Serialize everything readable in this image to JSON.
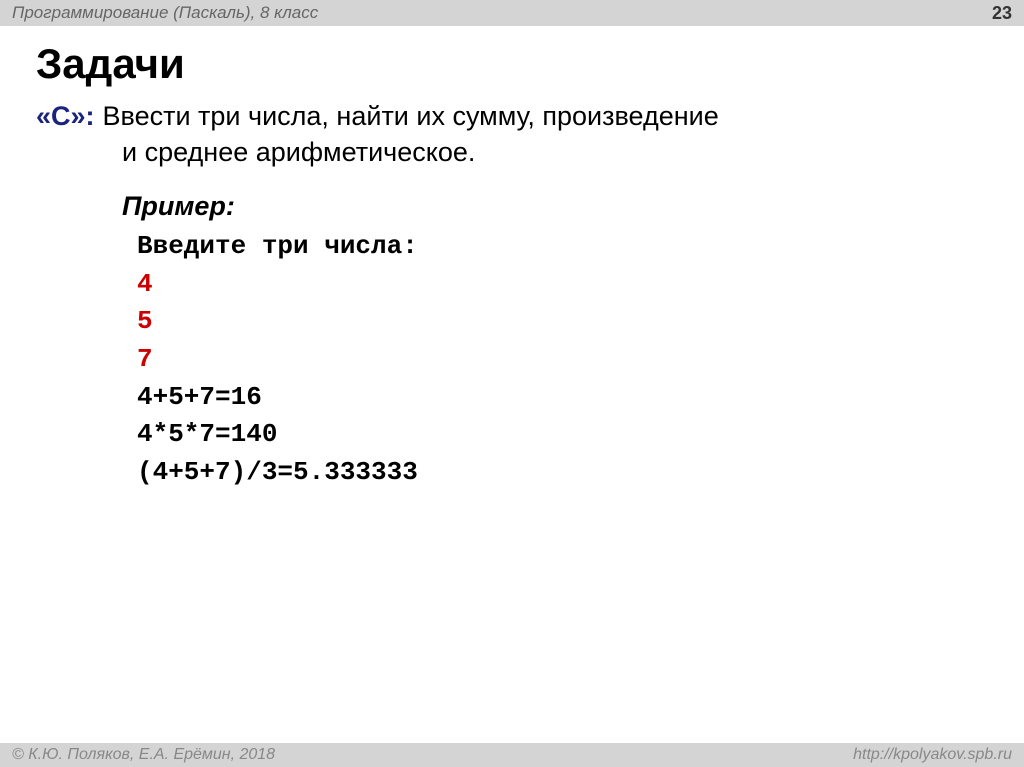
{
  "header": {
    "left": "Программирование (Паскаль), 8 класс",
    "right": "23"
  },
  "title": "Задачи",
  "task": {
    "label": "«C»:",
    "line1": "Ввести три числа, найти их сумму, произведение",
    "line2": "и среднее арифметическое."
  },
  "example": {
    "label": "Пример:",
    "lines": [
      {
        "text": "Введите три числа:",
        "color": "black"
      },
      {
        "text": "4",
        "color": "red"
      },
      {
        "text": "5",
        "color": "red"
      },
      {
        "text": "7",
        "color": "red"
      },
      {
        "text": "4+5+7=16",
        "color": "black"
      },
      {
        "text": "4*5*7=140",
        "color": "black"
      },
      {
        "text": "(4+5+7)/3=5.333333",
        "color": "black"
      }
    ]
  },
  "footer": {
    "left": "© К.Ю. Поляков, Е.А. Ерёмин, 2018",
    "right": "http://kpolyakov.spb.ru"
  }
}
